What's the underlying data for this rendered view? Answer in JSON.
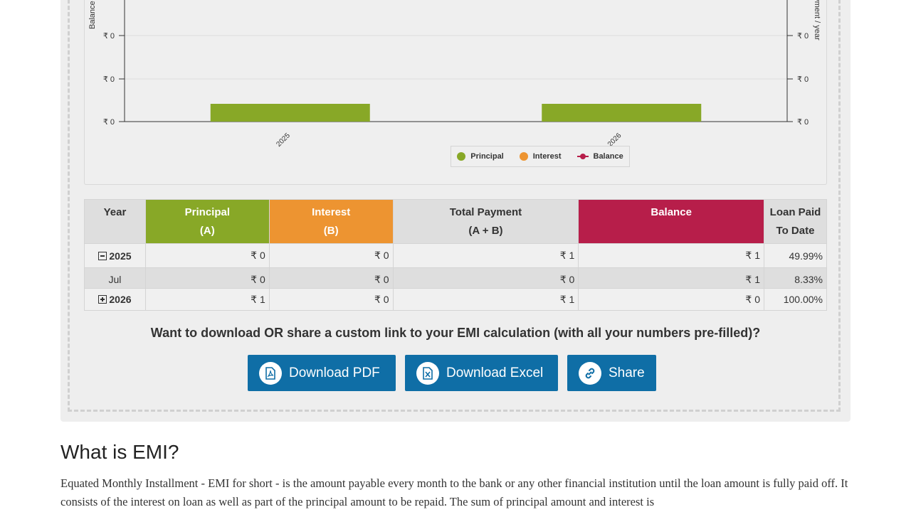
{
  "chart_data": {
    "type": "bar",
    "categories": [
      "2025",
      "2026"
    ],
    "series": [
      {
        "name": "Principal",
        "values": [
          0,
          1
        ],
        "color": "#88a827"
      },
      {
        "name": "Interest",
        "values": [
          0,
          0
        ],
        "color": "#ed9431"
      },
      {
        "name": "Balance",
        "values": [
          1,
          0
        ],
        "color": "#b71e4a"
      }
    ],
    "ylabel_left": "Balance",
    "ylabel_right": "ayment / year",
    "left_ticks": [
      "₹ 0",
      "₹ 0",
      "₹ 0"
    ],
    "right_ticks": [
      "₹ 0",
      "₹ 0",
      "₹ 0"
    ],
    "legend_position": "bottom-center",
    "grid": true
  },
  "legend": [
    "Principal",
    "Interest",
    "Balance"
  ],
  "table": {
    "headers": [
      {
        "line1": "Year",
        "line2": ""
      },
      {
        "line1": "Principal",
        "line2": "(A)"
      },
      {
        "line1": "Interest",
        "line2": "(B)"
      },
      {
        "line1": "Total Payment",
        "line2": "(A + B)"
      },
      {
        "line1": "Balance",
        "line2": ""
      },
      {
        "line1": "Loan Paid",
        "line2": "To Date"
      }
    ],
    "rows": [
      {
        "year": "2025",
        "principal": "₹ 0",
        "interest": "₹ 0",
        "total": "₹ 1",
        "balance": "₹ 1",
        "paid": "49.99%"
      },
      {
        "year": "Jul",
        "principal": "₹ 0",
        "interest": "₹ 0",
        "total": "₹ 0",
        "balance": "₹ 1",
        "paid": "8.33%"
      },
      {
        "year": "2026",
        "principal": "₹ 1",
        "interest": "₹ 0",
        "total": "₹ 1",
        "balance": "₹ 0",
        "paid": "100.00%"
      }
    ]
  },
  "cta_text": "Want to download OR share a custom link to your EMI calculation (with all your numbers pre-filled)?",
  "buttons": {
    "pdf": "Download PDF",
    "excel": "Download Excel",
    "share": "Share"
  },
  "what_is_emi": {
    "title": "What is EMI?",
    "text": "Equated Monthly Installment - EMI for short - is the amount payable every month to the bank or any other financial institution until the loan amount is fully paid off. It consists of the interest on loan as well as part of the principal amount to be repaid. The sum of principal amount and interest is"
  }
}
